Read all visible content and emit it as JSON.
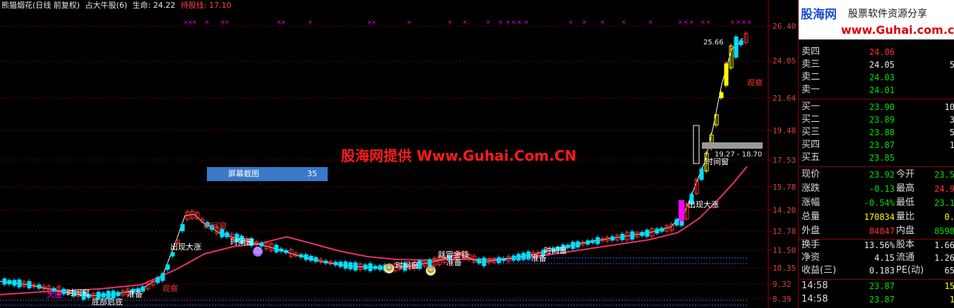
{
  "header": {
    "stock_name": "熊猫烟花(日线 前复权)",
    "indicator_name": "占大牛股(6)",
    "life_label": "生命: 24.22",
    "hold_line_label": "持股线: 17.10"
  },
  "watermark": "股海网提供 Www.Guhai.Com.CN",
  "screenshot_tip": {
    "label": "屏幕截图",
    "value": "35"
  },
  "price_axis": [
    "26.40",
    "24.05",
    "21.64",
    "19.48",
    "17.53",
    "15.78",
    "14.20",
    "12.78",
    "11.50",
    "10.35",
    "9.32",
    "8.39"
  ],
  "chart_labels": {
    "peak_price": "25.66",
    "range_label": "19.27 - 18.70",
    "annotations": [
      "出现大涨",
      "时间窗",
      "准备",
      "观察",
      "底部启底",
      "大底",
      "时间窗",
      "时间窗",
      "时间窗",
      "就冒金钱",
      "准备",
      "时间窗",
      "准备",
      "出现大涨",
      "时间窗",
      "观察"
    ]
  },
  "colors": {
    "background": "#000000",
    "ma_line": "#e8306a",
    "price_line": "#ffffff",
    "up": "#ff3030",
    "down": "#00e0ff",
    "signal": "#ffff00",
    "accent_magenta": "#ff00ff"
  },
  "banner": {
    "brand": "股海网",
    "slogan": "股票软件资源分享",
    "url": "www.Guhai.com.cn"
  },
  "quotes": {
    "sell": [
      {
        "label": "卖四",
        "price": "24.06",
        "vol": ""
      },
      {
        "label": "卖三",
        "price": "24.05",
        "vol": "5"
      },
      {
        "label": "卖二",
        "price": "24.03",
        "vol": ""
      },
      {
        "label": "卖一",
        "price": "24.01",
        "vol": ""
      }
    ],
    "buy": [
      {
        "label": "买一",
        "price": "23.90",
        "vol": "10"
      },
      {
        "label": "买二",
        "price": "23.89",
        "vol": "3"
      },
      {
        "label": "买三",
        "price": "23.88",
        "vol": "5"
      },
      {
        "label": "买四",
        "price": "23.87",
        "vol": "1"
      },
      {
        "label": "买五",
        "price": "23.85",
        "vol": ""
      }
    ]
  },
  "stats": [
    {
      "l1": "现价",
      "v1": "23.92",
      "l2": "今开",
      "v2": "23.5"
    },
    {
      "l1": "涨跌",
      "v1": "-0.13",
      "l2": "最高",
      "v2": "24.9"
    },
    {
      "l1": "涨幅",
      "v1": "-0.54%",
      "l2": "最低",
      "v2": "23.1"
    },
    {
      "l1": "总量",
      "v1": "170834",
      "l2": "量比",
      "v2": "0."
    },
    {
      "l1": "外盘",
      "v1": "84847",
      "l2": "内盘",
      "v2": "8598"
    }
  ],
  "stats2": [
    {
      "l1": "换手",
      "v1": "13.56%",
      "l2": "股本",
      "v2": "1.66"
    },
    {
      "l1": "净资",
      "v1": "4.15",
      "l2": "流通",
      "v2": "1.26"
    },
    {
      "l1": "收益(三)",
      "v1": "0.183",
      "l2": "PE(动)",
      "v2": "65"
    }
  ],
  "ticks": [
    {
      "time": "14:58",
      "price": "23.87",
      "vol": "15"
    },
    {
      "time": "14:58",
      "price": "23.87",
      "vol": "1"
    }
  ]
}
